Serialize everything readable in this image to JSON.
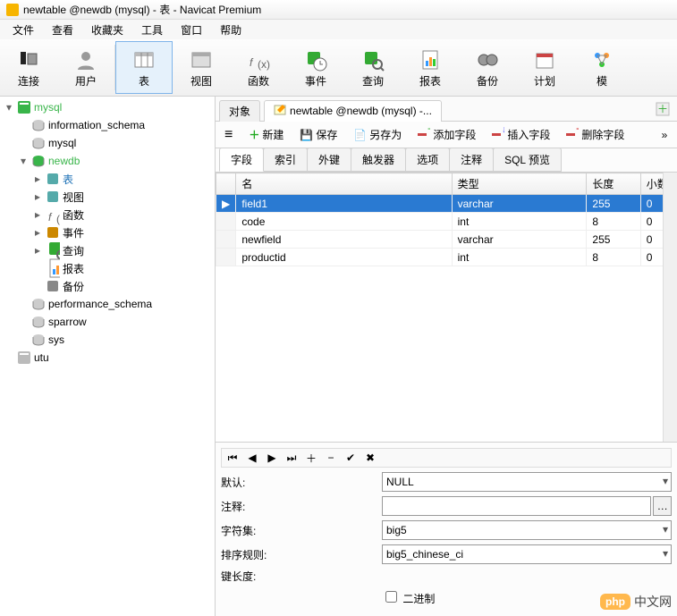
{
  "window": {
    "title": "newtable @newdb (mysql) - 表 - Navicat Premium"
  },
  "menu": [
    "文件",
    "查看",
    "收藏夹",
    "工具",
    "窗口",
    "帮助"
  ],
  "toolbar": [
    {
      "key": "connect",
      "label": "连接",
      "icon": "plug"
    },
    {
      "key": "user",
      "label": "用户",
      "icon": "person"
    },
    {
      "sep": true
    },
    {
      "key": "table",
      "label": "表",
      "icon": "table",
      "active": true
    },
    {
      "key": "view",
      "label": "视图",
      "icon": "view"
    },
    {
      "key": "func",
      "label": "函数",
      "icon": "fx"
    },
    {
      "key": "event",
      "label": "事件",
      "icon": "clock"
    },
    {
      "key": "query",
      "label": "查询",
      "icon": "query"
    },
    {
      "key": "report",
      "label": "报表",
      "icon": "report"
    },
    {
      "key": "backup",
      "label": "备份",
      "icon": "reel"
    },
    {
      "key": "plan",
      "label": "计划",
      "icon": "calendar"
    },
    {
      "key": "model",
      "label": "模",
      "icon": "model"
    }
  ],
  "tree": [
    {
      "level": 0,
      "exp": "▾",
      "icon": "server",
      "label": "mysql",
      "color": "#39b54a"
    },
    {
      "level": 1,
      "exp": "",
      "icon": "db",
      "label": "information_schema"
    },
    {
      "level": 1,
      "exp": "",
      "icon": "db",
      "label": "mysql"
    },
    {
      "level": 1,
      "exp": "▾",
      "icon": "db-open",
      "label": "newdb",
      "color": "#39b54a"
    },
    {
      "level": 2,
      "exp": "▸",
      "icon": "tables",
      "label": "表",
      "selected": true
    },
    {
      "level": 2,
      "exp": "▸",
      "icon": "views",
      "label": "视图"
    },
    {
      "level": 2,
      "exp": "▸",
      "icon": "fx",
      "label": "函数"
    },
    {
      "level": 2,
      "exp": "▸",
      "icon": "event",
      "label": "事件"
    },
    {
      "level": 2,
      "exp": "▸",
      "icon": "query",
      "label": "查询"
    },
    {
      "level": 2,
      "exp": "",
      "icon": "report",
      "label": "报表"
    },
    {
      "level": 2,
      "exp": "",
      "icon": "backup",
      "label": "备份"
    },
    {
      "level": 1,
      "exp": "",
      "icon": "db",
      "label": "performance_schema"
    },
    {
      "level": 1,
      "exp": "",
      "icon": "db",
      "label": "sparrow"
    },
    {
      "level": 1,
      "exp": "",
      "icon": "db",
      "label": "sys"
    },
    {
      "level": 0,
      "exp": "",
      "icon": "server-off",
      "label": "utu"
    }
  ],
  "tabs": {
    "items": [
      "对象",
      "newtable @newdb (mysql) -..."
    ],
    "active": 1,
    "addIcon": "plus"
  },
  "actionbar": {
    "menu": "≡",
    "new": "新建",
    "save": "保存",
    "saveAs": "另存为",
    "addField": "添加字段",
    "insertField": "插入字段",
    "deleteField": "删除字段",
    "more": "»"
  },
  "subTabs": {
    "items": [
      "字段",
      "索引",
      "外键",
      "触发器",
      "选项",
      "注释",
      "SQL 预览"
    ],
    "active": 0
  },
  "grid": {
    "columns": [
      "名",
      "类型",
      "长度",
      "小数"
    ],
    "rows": [
      {
        "name": "field1",
        "type": "varchar",
        "length": "255",
        "decimal": "0",
        "selected": true
      },
      {
        "name": "code",
        "type": "int",
        "length": "8",
        "decimal": "0"
      },
      {
        "name": "newfield",
        "type": "varchar",
        "length": "255",
        "decimal": "0"
      },
      {
        "name": "productid",
        "type": "int",
        "length": "8",
        "decimal": "0"
      }
    ]
  },
  "form": {
    "default": {
      "label": "默认:",
      "value": "NULL"
    },
    "comment": {
      "label": "注释:",
      "value": ""
    },
    "charset": {
      "label": "字符集:",
      "value": "big5"
    },
    "collation": {
      "label": "排序规则:",
      "value": "big5_chinese_ci"
    },
    "keylen": {
      "label": "键长度:",
      "value": ""
    },
    "binary": {
      "label": "二进制",
      "checked": false
    }
  },
  "watermark": {
    "badge": "php",
    "text": "中文网"
  }
}
